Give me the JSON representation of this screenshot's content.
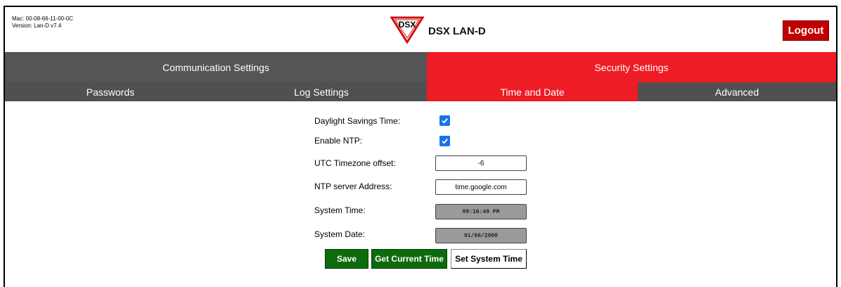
{
  "header": {
    "mac": "Mac: 00-08-66-11-00-0C",
    "version": "Version: Lan-D v7.4",
    "logo_text": "DSX",
    "title": "DSX LAN-D",
    "logout_label": "Logout"
  },
  "main_tabs": [
    {
      "label": "Communication Settings",
      "active": false
    },
    {
      "label": "Security Settings",
      "active": true
    }
  ],
  "sub_tabs": [
    {
      "label": "Passwords",
      "active": false
    },
    {
      "label": "Log Settings",
      "active": false
    },
    {
      "label": "Time and Date",
      "active": true
    },
    {
      "label": "Advanced",
      "active": false
    }
  ],
  "form": {
    "dst_label": "Daylight Savings Time:",
    "dst_checked": true,
    "ntp_label": "Enable NTP:",
    "ntp_checked": true,
    "utc_label": "UTC Timezone offset:",
    "utc_value": "-6",
    "server_label": "NTP server Address:",
    "server_value": "time.google.com",
    "time_label": "System Time:",
    "time_value": "09:16:49 PM",
    "date_label": "System Date:",
    "date_value": "01/06/2000"
  },
  "buttons": {
    "save": "Save",
    "get_time": "Get Current Time",
    "set_time": "Set System Time"
  },
  "colors": {
    "accent_red": "#ee1c24",
    "tab_gray": "#555555",
    "button_green": "#0d6b0d",
    "logout_red": "#c00000",
    "checkbox_blue": "#1a73e8"
  }
}
